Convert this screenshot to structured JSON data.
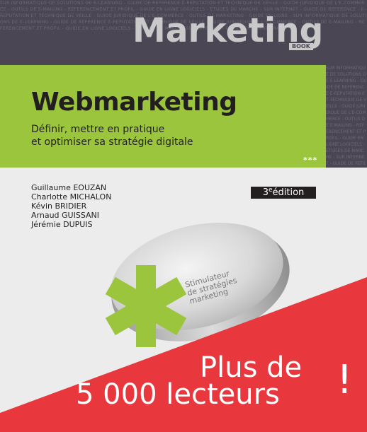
{
  "series": {
    "title": "Marketing",
    "subtitle": "BOOK",
    "background_text": "SUR INFORMATIQUE DE SOLUTIONS DE E-LEARNING - GUIDE DE REFERENCE E-REPUTATION ET TECHNIQUE DE VEILLE - GUIDE JURIDIQUE DE L'E-COMMERCE - OUTILS DE E-MAILING - REFERENCEMENT ET PROFIL - GUIDE EN LIGNE LOGICIELS - ETUDES DE MARCHE - SUR INTERNET - GUIDE DE REFERENCE - E-REPUTATION ET TECHNIQUE DE VEILLE - GUIDE JURIDIQUE DE L'E-COMMERCE - OUTILS DE MARKETING - GUIDE EN LIGNE - SUR INFORMATIQUE DE SOLUTIONS DE E-LEARNING - GUIDE DE REFERENCE E-REPUTATION ET TECHNIQUE DE VEILLE - GUIDE JURIDIQUE DE L'E-COMMERCE - OUTILS DE E-MAILING - REFERENCEMENT ET PROFIL - GUIDE EN LIGNE LOGICIELS - ETUDES DE MARCHE SUR INTERNET - OUTILS DE MARKETING"
  },
  "book": {
    "title": "Webmarketing",
    "subtitle_line1": "Définir, mettre en pratique",
    "subtitle_line2": "et optimiser sa stratégie digitale",
    "stars": "***",
    "authors": [
      "Guillaume EOUZAN",
      "Charlotte MICHALON",
      "Kévin BRIDIER",
      "Arnaud GUISSANI",
      "Jérémie DUPUIS"
    ],
    "edition_number": "3",
    "edition_sup": "e",
    "edition_word": "édition",
    "tin_label": [
      "Stimulateur",
      "de stratégies",
      "marketing"
    ]
  },
  "promo": {
    "line1": "Plus de",
    "line2": "5 000 lecteurs",
    "exclamation": "!"
  },
  "colors": {
    "dark_band": "#4a4654",
    "green": "#9bc53d",
    "red": "#e8373d",
    "ink": "#231f20"
  }
}
